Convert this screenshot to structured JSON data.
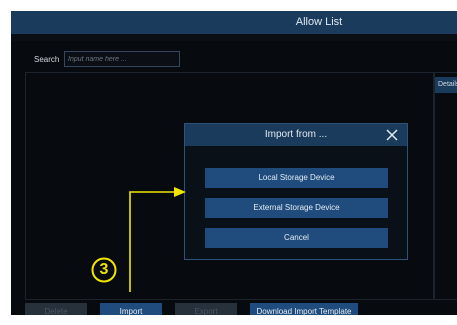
{
  "window": {
    "title": "Allow List"
  },
  "search": {
    "label": "Search",
    "placeholder": "Input name here ..."
  },
  "detail_panel": {
    "tab_label": "Details"
  },
  "bottom_buttons": {
    "delete": "Delete",
    "import": "Import",
    "export": "Export",
    "download_template": "Download Import Template"
  },
  "dialog": {
    "title": "Import from ...",
    "options": {
      "local": "Local Storage Device",
      "external": "External Storage Device",
      "cancel": "Cancel"
    }
  },
  "annotation": {
    "step": "3",
    "step_display": "③",
    "color": "#f2e600"
  },
  "colors": {
    "title_bar": "#1b3b5c",
    "button_active": "#1f4c7c",
    "button_disabled": "#27313c",
    "background": "#070a0f"
  }
}
